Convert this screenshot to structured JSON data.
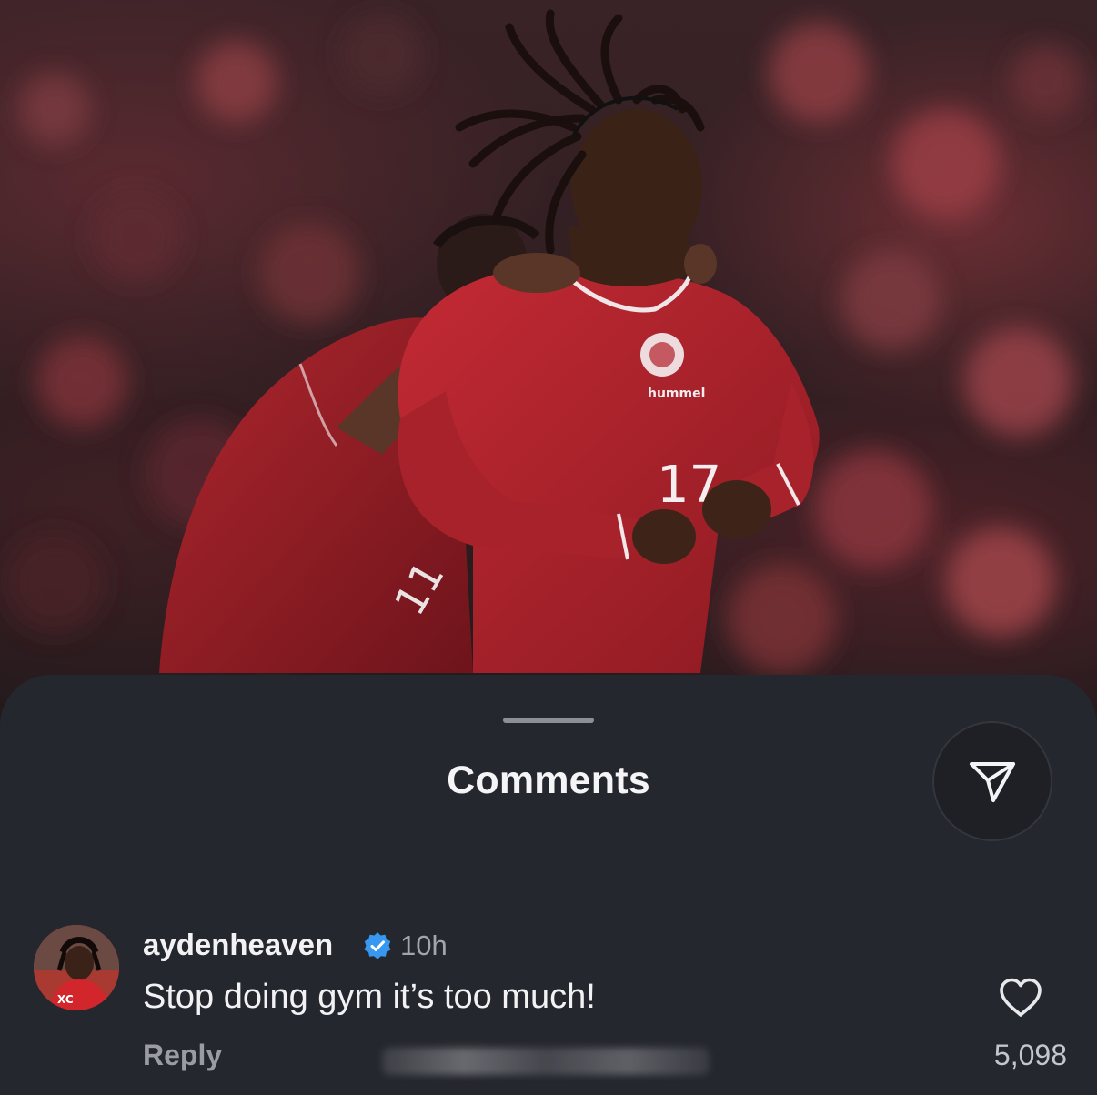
{
  "sheet": {
    "title": "Comments",
    "share_icon": "send-paper-plane-icon"
  },
  "comment": {
    "username": "aydenheaven",
    "verified_icon": "verified-badge-icon",
    "timestamp": "10h",
    "text": "Stop doing gym it’s too much!",
    "reply_label": "Reply",
    "like_icon": "heart-outline-icon",
    "like_count": "5,098"
  },
  "photo": {
    "jersey_number_front": "17",
    "jersey_number_back": "11",
    "kit_brand": "hummel"
  },
  "colors": {
    "sheet_bg": "#25272e",
    "jersey_red": "#b4222c",
    "verified_blue": "#3897f0"
  }
}
